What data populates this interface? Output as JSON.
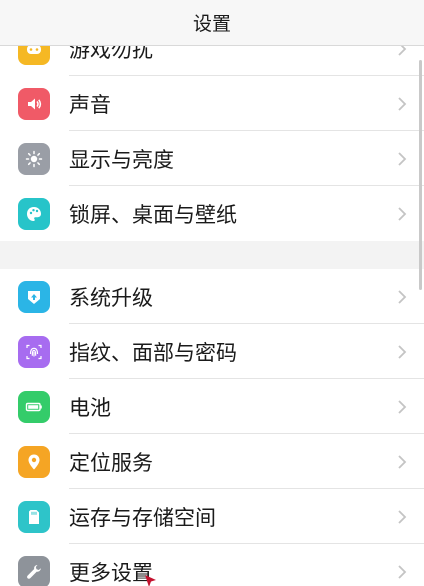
{
  "header": {
    "title": "设置"
  },
  "group1": {
    "items": [
      {
        "label": "游戏勿扰",
        "icon": "game-icon",
        "color": "#f5b824"
      },
      {
        "label": "声音",
        "icon": "speaker-icon",
        "color": "#f05a67"
      },
      {
        "label": "显示与亮度",
        "icon": "brightness-icon",
        "color": "#9a9ea6"
      },
      {
        "label": "锁屏、桌面与壁纸",
        "icon": "palette-icon",
        "color": "#27c4c9"
      }
    ]
  },
  "group2": {
    "items": [
      {
        "label": "系统升级",
        "icon": "upgrade-icon",
        "color": "#2bb5e6"
      },
      {
        "label": "指纹、面部与密码",
        "icon": "fingerprint-icon",
        "color": "#a76cf0"
      },
      {
        "label": "电池",
        "icon": "battery-icon",
        "color": "#34cc6a"
      },
      {
        "label": "定位服务",
        "icon": "location-icon",
        "color": "#f5a524"
      },
      {
        "label": "运存与存储空间",
        "icon": "storage-icon",
        "color": "#2ec4c9"
      },
      {
        "label": "更多设置",
        "icon": "wrench-icon",
        "color": "#8e939a"
      }
    ]
  }
}
